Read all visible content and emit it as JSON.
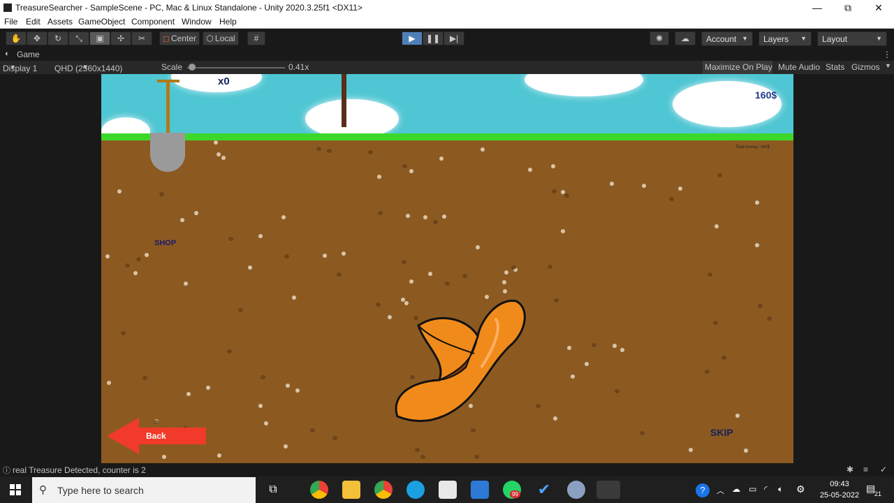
{
  "window": {
    "title": "TreasureSearcher - SampleScene - PC, Mac & Linux Standalone - Unity 2020.3.25f1 <DX11>",
    "controls": {
      "minimize": "—",
      "maximize": "⧉",
      "close": "✕"
    }
  },
  "menu": [
    "File",
    "Edit",
    "Assets",
    "GameObject",
    "Component",
    "Window",
    "Help"
  ],
  "toolbar": {
    "pivot_label": "Center",
    "space_label": "Local",
    "account_label": "Account",
    "layers_label": "Layers",
    "layout_label": "Layout",
    "play_state": "playing"
  },
  "game_panel": {
    "tab_label": "Game",
    "display": "Display 1",
    "resolution": "QHD (2560x1440)",
    "scale_label": "Scale",
    "scale_value": "0.41x",
    "scale_fraction": 0.05,
    "maximize_label": "Maximize On Play",
    "mute_label": "Mute Audio",
    "stats_label": "Stats",
    "gizmos_label": "Gizmos"
  },
  "game": {
    "counter": "x0",
    "money": "160$",
    "total_money": "Total money: 160$",
    "shop_label": "SHOP",
    "back_label": "Back",
    "skip_label": "SKIP",
    "colors": {
      "sky": "#4fc6d3",
      "grass": "#3bd82a",
      "dirt": "#8c5a21",
      "hat": "#f08a1a",
      "back_arrow": "#f23a2a"
    }
  },
  "status": {
    "message": "real Treasure Detected, counter is 2"
  },
  "taskbar": {
    "search_placeholder": "Type here to search",
    "whatsapp_badge": "99",
    "time": "09:43",
    "date": "25-05-2022",
    "notification_count": "21"
  }
}
